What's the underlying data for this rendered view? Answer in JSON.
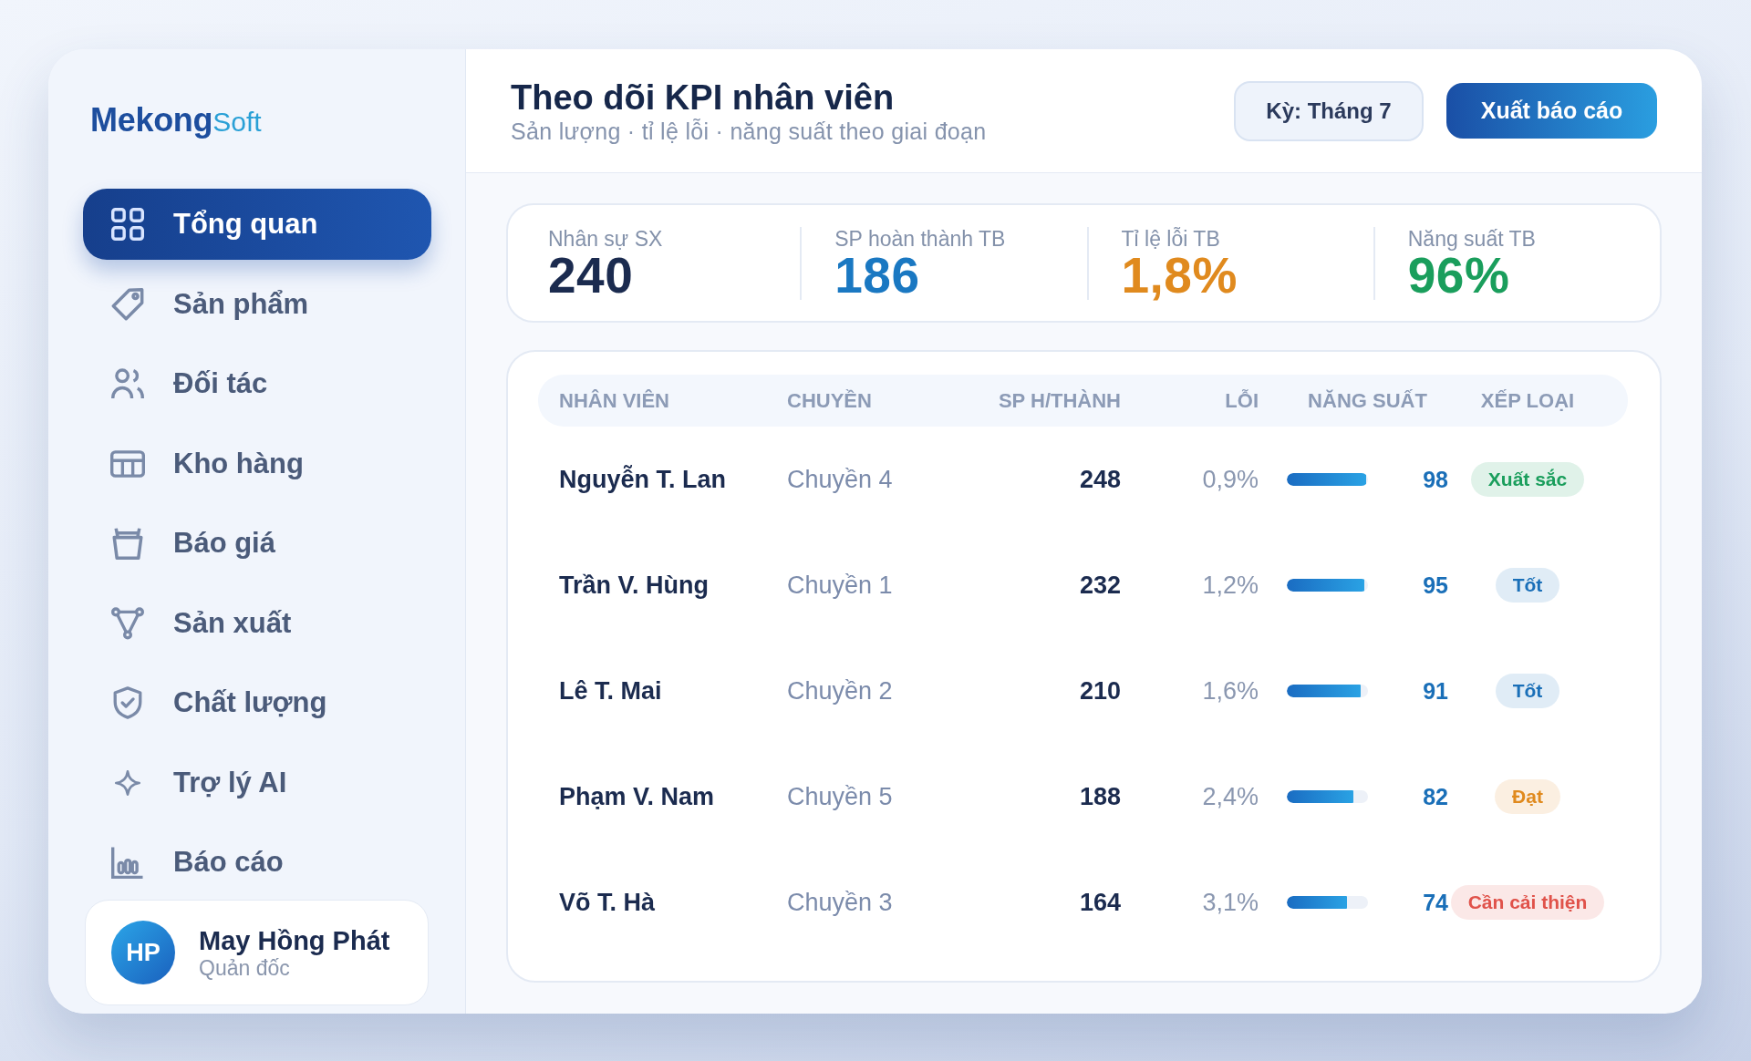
{
  "sidebar": {
    "brand": {
      "name": "Mekong",
      "suffix": "Soft"
    },
    "items": [
      {
        "label": "Tổng quan",
        "selected": true
      },
      {
        "label": "Sản phẩm",
        "selected": false
      },
      {
        "label": "Đối tác",
        "selected": false
      },
      {
        "label": "Kho hàng",
        "selected": false
      },
      {
        "label": "Báo giá",
        "selected": false
      },
      {
        "label": "Sản xuất",
        "selected": false
      },
      {
        "label": "Chất lượng",
        "selected": false
      },
      {
        "label": "Trợ lý AI",
        "selected": false
      },
      {
        "label": "Báo cáo",
        "selected": false
      }
    ],
    "user": {
      "initials": "HP",
      "name": "May Hồng Phát",
      "role": "Quản đốc"
    }
  },
  "header": {
    "title": "Theo dõi KPI nhân viên",
    "subtitle": "Sản lượng · tỉ lệ lỗi · năng suất theo giai đoạn",
    "period_button": "Kỳ: Tháng 7",
    "export_button": "Xuất báo cáo"
  },
  "kpis": [
    {
      "label": "Nhân sự SX",
      "value": "240",
      "color": "#1b2b4f"
    },
    {
      "label": "SP hoàn thành TB",
      "value": "186",
      "color": "#1a78c2"
    },
    {
      "label": "Tỉ lệ lỗi TB",
      "value": "1,8%",
      "color": "#e08a1e"
    },
    {
      "label": "Năng suất TB",
      "value": "96%",
      "color": "#1a9e5c"
    }
  ],
  "table": {
    "columns": [
      "NHÂN VIÊN",
      "CHUYỀN",
      "SP H/THÀNH",
      "LỖI",
      "NĂNG SUẤT",
      "XẾP LOẠI"
    ],
    "rows": [
      {
        "name": "Nguyễn T. Lan",
        "line": "Chuyền 4",
        "output": "248",
        "defect": "0,9%",
        "productivity": {
          "level": 0.98,
          "reading": "98"
        },
        "rating": {
          "label": "Xuất sắc",
          "color": "#1a9e5c"
        }
      },
      {
        "name": "Trần V. Hùng",
        "line": "Chuyền 1",
        "output": "232",
        "defect": "1,2%",
        "productivity": {
          "level": 0.95,
          "reading": "95"
        },
        "rating": {
          "label": "Tốt",
          "color": "#1a6fb8"
        }
      },
      {
        "name": "Lê T. Mai",
        "line": "Chuyền 2",
        "output": "210",
        "defect": "1,6%",
        "productivity": {
          "level": 0.91,
          "reading": "91"
        },
        "rating": {
          "label": "Tốt",
          "color": "#1a6fb8"
        }
      },
      {
        "name": "Phạm V. Nam",
        "line": "Chuyền 5",
        "output": "188",
        "defect": "2,4%",
        "productivity": {
          "level": 0.82,
          "reading": "82"
        },
        "rating": {
          "label": "Đạt",
          "color": "#e08a1e"
        }
      },
      {
        "name": "Võ T. Hà",
        "line": "Chuyền 3",
        "output": "164",
        "defect": "3,1%",
        "productivity": {
          "level": 0.74,
          "reading": "74"
        },
        "rating": {
          "label": "Cần cải thiện",
          "color": "#e0524a"
        }
      }
    ]
  }
}
